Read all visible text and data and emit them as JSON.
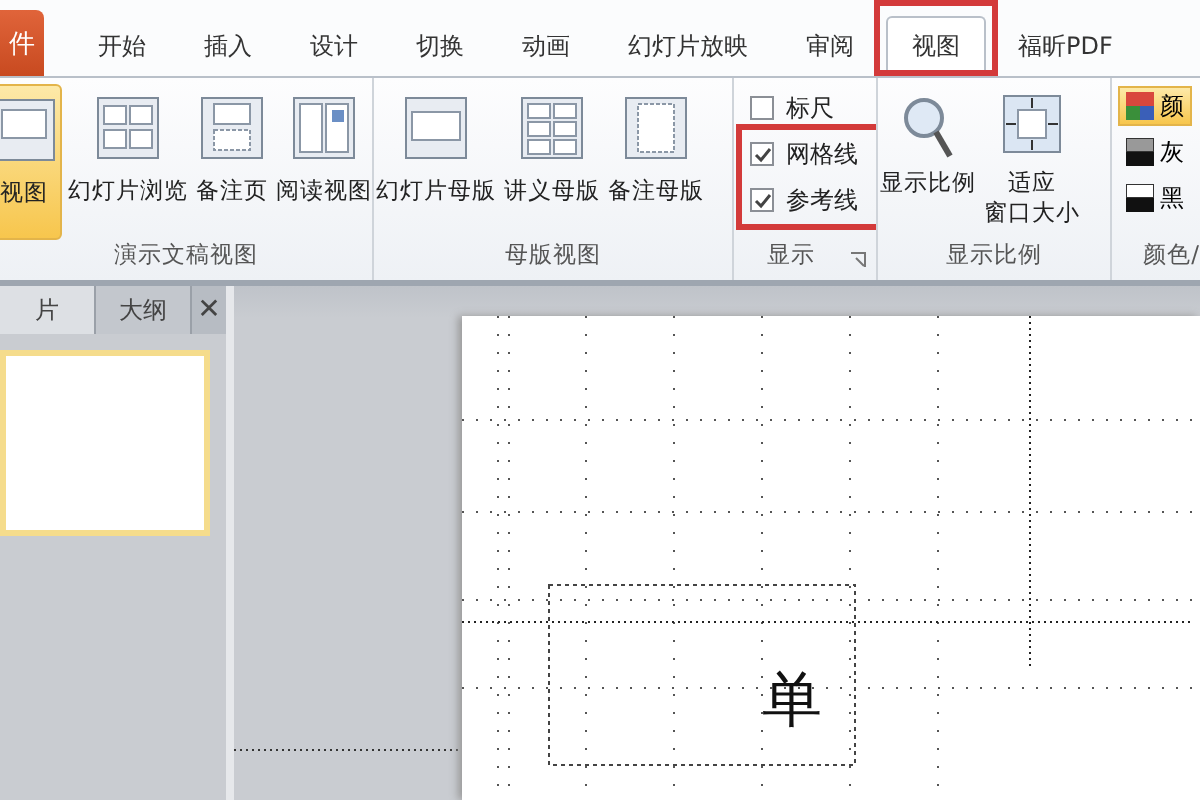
{
  "file_tab": {
    "label": "件"
  },
  "tabs": [
    {
      "label": "开始",
      "selected": false,
      "annotated": false
    },
    {
      "label": "插入",
      "selected": false,
      "annotated": false
    },
    {
      "label": "设计",
      "selected": false,
      "annotated": false
    },
    {
      "label": "切换",
      "selected": false,
      "annotated": false
    },
    {
      "label": "动画",
      "selected": false,
      "annotated": false
    },
    {
      "label": "幻灯片放映",
      "selected": false,
      "annotated": false
    },
    {
      "label": "审阅",
      "selected": false,
      "annotated": false
    },
    {
      "label": "视图",
      "selected": true,
      "annotated": true
    },
    {
      "label": "福昕PDF",
      "selected": false,
      "annotated": false
    }
  ],
  "ribbon_groups": [
    {
      "kind": "buttons",
      "label": "演示文稿视图",
      "buttons": [
        {
          "label": "视图",
          "selected": true
        },
        {
          "label": "幻灯片浏览",
          "selected": false
        },
        {
          "label": "备注页",
          "selected": false
        },
        {
          "label": "阅读视图",
          "selected": false
        }
      ]
    },
    {
      "kind": "buttons",
      "label": "母版视图",
      "buttons": [
        {
          "label": "幻灯片母版",
          "selected": false
        },
        {
          "label": "讲义母版",
          "selected": false
        },
        {
          "label": "备注母版",
          "selected": false
        }
      ]
    },
    {
      "kind": "checks",
      "label": "显示",
      "launcher": true,
      "items": [
        {
          "label": "标尺",
          "checked": false,
          "annotated": false
        },
        {
          "label": "网格线",
          "checked": true,
          "annotated": true
        },
        {
          "label": "参考线",
          "checked": true,
          "annotated": true
        }
      ]
    },
    {
      "kind": "zoom",
      "label": "显示比例",
      "buttons": [
        {
          "label": "显示比例"
        },
        {
          "lines": [
            "适应",
            "窗口大小"
          ]
        }
      ]
    },
    {
      "kind": "swatches",
      "label": "颜色/",
      "items": [
        {
          "label": "颜",
          "selected": true
        },
        {
          "label": "灰",
          "selected": false
        },
        {
          "label": "黑",
          "selected": false
        }
      ]
    }
  ],
  "pane_tabs": [
    {
      "label": "片",
      "selected": true
    },
    {
      "label": "大纲",
      "selected": false
    }
  ],
  "pane_close": "✕",
  "thumbnail": {
    "selected": true
  },
  "slide": {
    "title": "单"
  }
}
